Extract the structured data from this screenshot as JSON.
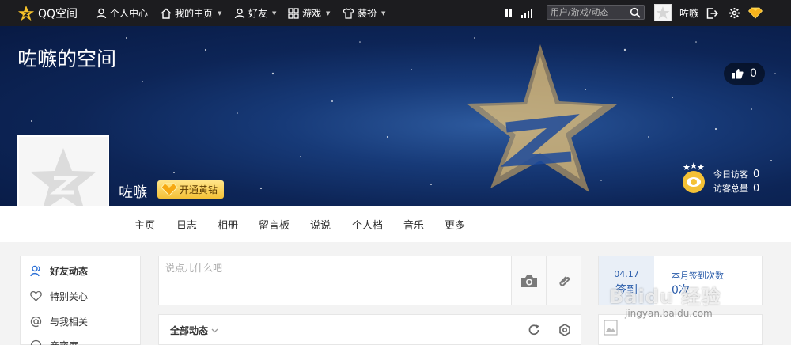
{
  "topbar": {
    "logo_label": "QQ空间",
    "personal_center": "个人中心",
    "my_home": "我的主页",
    "friends": "好友",
    "games": "游戏",
    "dressup": "装扮",
    "search_placeholder": "用户/游戏/动态",
    "username": "咗嗾"
  },
  "banner": {
    "space_title": "咗嗾的空间",
    "like_count": "0",
    "user_name": "咗嗾",
    "yellow_diamond_label": "开通黄钻",
    "today_visitors_label": "今日访客",
    "today_visitors": "0",
    "total_visitors_label": "访客总量",
    "total_visitors": "0"
  },
  "nav": {
    "items": [
      "主页",
      "日志",
      "相册",
      "留言板",
      "说说",
      "个人档",
      "音乐",
      "更多"
    ]
  },
  "sidebar": {
    "items": [
      "好友动态",
      "特别关心",
      "与我相关",
      "亲密度"
    ]
  },
  "postbox": {
    "placeholder": "说点儿什么吧"
  },
  "feed": {
    "title": "全部动态"
  },
  "signin": {
    "date": "04.17",
    "button": "签到",
    "label": "本月签到次数",
    "count": "0次"
  },
  "watermark": {
    "text": "Baidu 经验",
    "sub": "jingyan.baidu.com"
  },
  "colors": {
    "topbar_bg": "#1c1c1f",
    "banner_bg": "#0d2557",
    "accent_gold": "#f4c136",
    "signin_blue": "#2a5caa"
  }
}
